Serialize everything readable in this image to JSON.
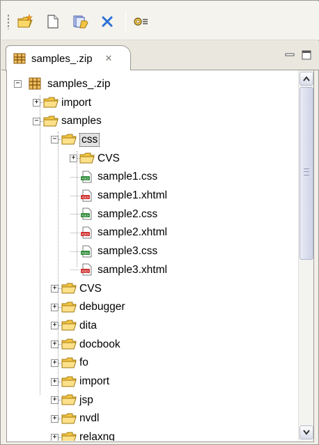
{
  "toolbar": {
    "buttons": [
      {
        "name": "new-folder-icon"
      },
      {
        "name": "new-file-icon"
      },
      {
        "name": "add-files-icon"
      },
      {
        "name": "delete-icon"
      },
      {
        "name": "properties-icon"
      }
    ]
  },
  "tab": {
    "label": "samples_.zip",
    "close_glyph": "✕"
  },
  "tree": {
    "root": "samples_.zip",
    "items": [
      {
        "label": "import",
        "type": "folder",
        "level": 1,
        "state": "collapsed"
      },
      {
        "label": "samples",
        "type": "folder",
        "level": 1,
        "state": "expanded"
      },
      {
        "label": "css",
        "type": "folder",
        "level": 2,
        "state": "expanded",
        "selected": true
      },
      {
        "label": "CVS",
        "type": "folder",
        "level": 3,
        "state": "collapsed"
      },
      {
        "label": "sample1.css",
        "type": "css-file",
        "level": 3
      },
      {
        "label": "sample1.xhtml",
        "type": "xhtml-file",
        "level": 3
      },
      {
        "label": "sample2.css",
        "type": "css-file",
        "level": 3
      },
      {
        "label": "sample2.xhtml",
        "type": "xhtml-file",
        "level": 3
      },
      {
        "label": "sample3.css",
        "type": "css-file",
        "level": 3
      },
      {
        "label": "sample3.xhtml",
        "type": "xhtml-file",
        "level": 3
      },
      {
        "label": "CVS",
        "type": "folder",
        "level": 2,
        "state": "collapsed"
      },
      {
        "label": "debugger",
        "type": "folder",
        "level": 2,
        "state": "collapsed"
      },
      {
        "label": "dita",
        "type": "folder",
        "level": 2,
        "state": "collapsed"
      },
      {
        "label": "docbook",
        "type": "folder",
        "level": 2,
        "state": "collapsed"
      },
      {
        "label": "fo",
        "type": "folder",
        "level": 2,
        "state": "collapsed"
      },
      {
        "label": "import",
        "type": "folder",
        "level": 2,
        "state": "collapsed"
      },
      {
        "label": "jsp",
        "type": "folder",
        "level": 2,
        "state": "collapsed"
      },
      {
        "label": "nvdl",
        "type": "folder",
        "level": 2,
        "state": "collapsed"
      },
      {
        "label": "relaxng",
        "type": "folder",
        "level": 2,
        "state": "collapsed"
      }
    ]
  },
  "colors": {
    "folder": "#f4c542",
    "css_badge": "#2e8b3a",
    "xhtml_badge": "#d13030",
    "archive": "#b8862b",
    "delete": "#2b6fd6"
  }
}
